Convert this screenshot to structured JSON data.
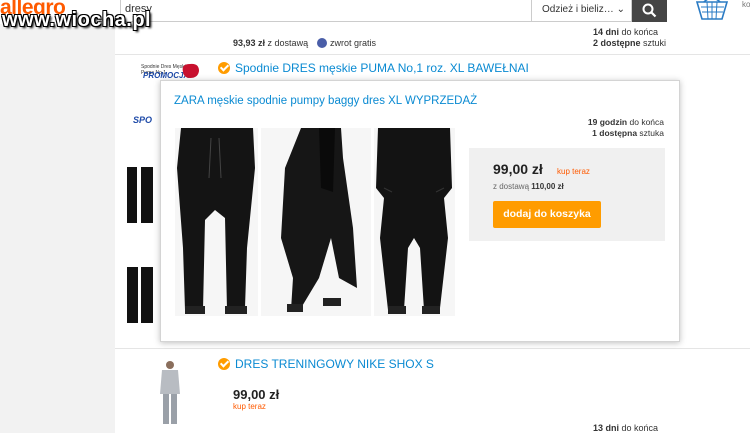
{
  "header": {
    "logo": "allegro",
    "search_value": "dresy",
    "category": "Odzież i bieliz…",
    "cart_label": "ko",
    "watermark": "www.wiocha.pl"
  },
  "listing": {
    "top_row": {
      "price": "93,93 zł",
      "price_suffix": "z dostawą",
      "return_label": "zwrot gratis",
      "time_value": "14 dni",
      "time_suffix": "do końca",
      "stock_value": "2 dostępne",
      "stock_suffix": "sztuki"
    },
    "item_puma": {
      "title": "Spodnie DRES męskie PUMA No,1 roz. XL BAWEŁNAI",
      "promo_text": "Spodnie Dres Męskie Puma No,1",
      "promo_word": "PROMOCJA",
      "promo_logo": "SPO"
    },
    "item_nike": {
      "title": "DRES TRENINGOWY NIKE SHOX S",
      "price": "99,00 zł",
      "buy_label": "kup teraz",
      "time_value": "13 dni",
      "time_suffix": "do końca"
    }
  },
  "popup": {
    "title": "ZARA męskie spodnie pumpy baggy dres XL WYPRZEDAŻ",
    "time_value": "19 godzin",
    "time_suffix": "do końca",
    "stock_value": "1 dostępna",
    "stock_suffix": "sztuka",
    "price": "99,00 zł",
    "buy_label": "kup teraz",
    "shipping_prefix": "z dostawą",
    "shipping_price": "110,00 zł",
    "add_to_cart": "dodaj do koszyka"
  },
  "colors": {
    "brand": "#ff5a00",
    "link": "#0a8ad2",
    "button": "#ff9c00",
    "search_button": "#454545"
  }
}
